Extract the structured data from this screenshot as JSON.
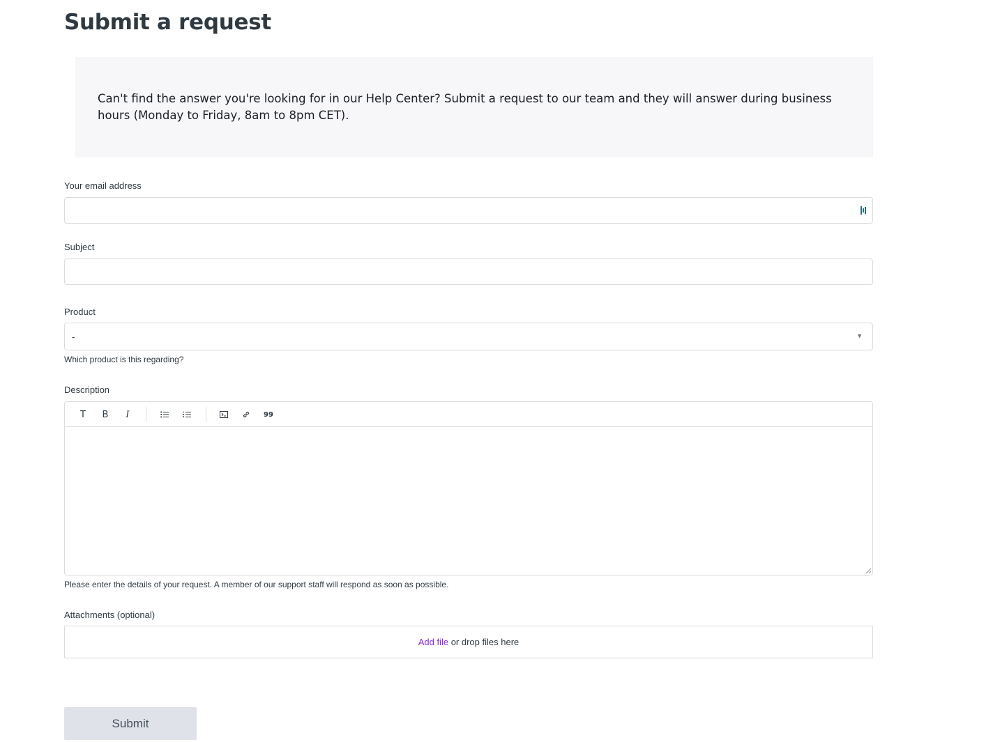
{
  "page": {
    "title": "Submit a request",
    "notice": "Can't find the answer you're looking for in our Help Center? Submit a request to our team and they will answer during business hours (Monday to Friday, 8am to 8pm CET)."
  },
  "form": {
    "email": {
      "label": "Your email address",
      "value": ""
    },
    "subject": {
      "label": "Subject",
      "value": ""
    },
    "product": {
      "label": "Product",
      "selected": "-",
      "hint": "Which product is this regarding?"
    },
    "description": {
      "label": "Description",
      "hint": "Please enter the details of your request. A member of our support staff will respond as soon as possible.",
      "toolbar": {
        "text": "T",
        "bold": "B",
        "italic": "I",
        "quote": "99"
      }
    },
    "attachments": {
      "label": "Attachments (optional)",
      "add_file": "Add file",
      "drop_text": " or drop files here"
    },
    "submit_label": "Submit"
  },
  "colors": {
    "link": "#8a2be2",
    "notice_bg": "#f7f7fa",
    "submit_bg": "#e0e2ea"
  },
  "icons": [
    "autofill-icon",
    "dropdown-caret-icon",
    "bullet-list-icon",
    "numbered-list-icon",
    "code-block-icon",
    "link-icon",
    "quote-icon",
    "resize-grip-icon"
  ]
}
